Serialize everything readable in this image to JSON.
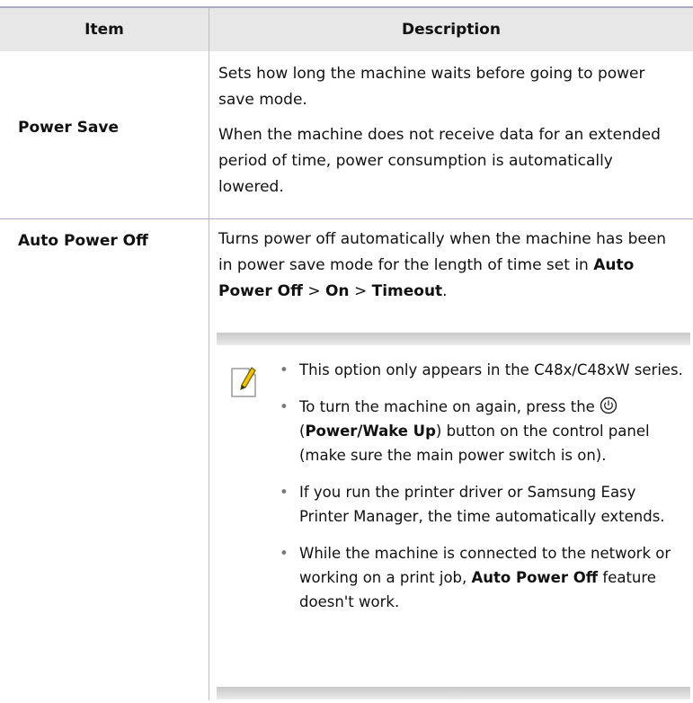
{
  "table": {
    "headers": {
      "item": "Item",
      "description": "Description"
    },
    "rows": [
      {
        "item": "Power Save",
        "paragraphs": [
          "Sets how long the machine waits before going to power save mode.",
          "When the machine does not receive data for an extended period of time, power consumption is automatically lowered."
        ]
      },
      {
        "item": "Auto Power Off",
        "text_before": "Turns power off automatically when the machine has been in power save mode for the length of time set in",
        "menu_path": {
          "a": "Auto Power Off",
          "sep1": ">",
          "b": "On",
          "sep2": ">",
          "c": "Timeout",
          "end": "."
        }
      }
    ]
  },
  "note": {
    "icon": "note-pencil-icon",
    "bullet_char": "•",
    "b1": {
      "pre": "This option only appears in the",
      "model": "C48x/C48xW",
      "post": "series."
    },
    "b2": {
      "pre": "To turn the machine on again, press the",
      "icon": "power-icon",
      "open": "(",
      "button": "Power/Wake Up",
      "post": ") button on the control panel (make sure the main power switch is on)."
    },
    "b3": {
      "pre": "If you run the printer driver or",
      "app": "Samsung Easy Printer Manager",
      "post": ", the time automatically extends."
    },
    "b4": {
      "pre": "While the machine is connected to the network or working on a print job,",
      "feature": "Auto Power Off",
      "post": "feature doesn't work."
    }
  },
  "colors": {
    "header_bg": "#e7e7e7",
    "rule": "#a9a9cc",
    "note_bar": "#d4d4d4",
    "icon_yellow": "#f2c200"
  }
}
